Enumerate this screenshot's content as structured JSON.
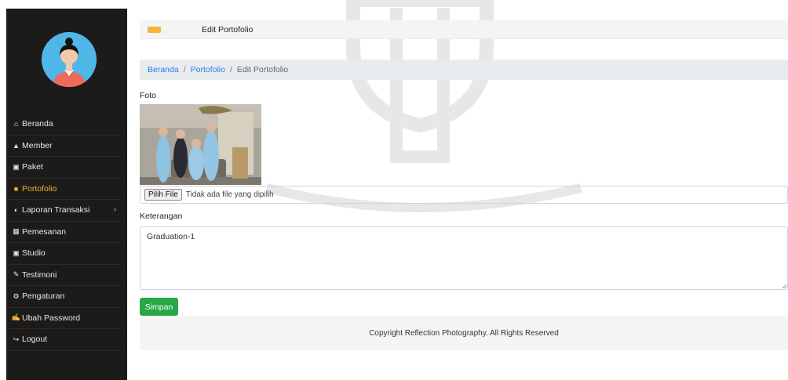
{
  "topbar": {
    "title": "Edit Portofolio"
  },
  "breadcrumb": {
    "home": "Beranda",
    "section": "Portofolio",
    "current": "Edit Portofolio",
    "separator": "/"
  },
  "sidebar": {
    "items": [
      {
        "label": "Beranda",
        "icon": "home-icon",
        "glyph": "⌂"
      },
      {
        "label": "Member",
        "icon": "user-icon",
        "glyph": "▲"
      },
      {
        "label": "Paket",
        "icon": "image-icon",
        "glyph": "▣"
      },
      {
        "label": "Portofolio",
        "icon": "book-icon",
        "glyph": "■",
        "active": true
      },
      {
        "label": "Laporan Transaksi",
        "icon": "report-icon",
        "glyph": "◐",
        "chevron": "›"
      },
      {
        "label": "Pemesanan",
        "icon": "calendar-icon",
        "glyph": "▦"
      },
      {
        "label": "Studio",
        "icon": "studio-icon",
        "glyph": "▣"
      },
      {
        "label": "Testimoni",
        "icon": "pencil-icon",
        "glyph": "✎"
      },
      {
        "label": "Pengaturan",
        "icon": "gear-icon",
        "glyph": "⚙"
      },
      {
        "label": "Ubah Password",
        "icon": "edit-icon",
        "glyph": "✍"
      },
      {
        "label": "Logout",
        "icon": "logout-icon",
        "glyph": "↪"
      }
    ]
  },
  "form": {
    "photo_label": "Foto",
    "file_button": "Pilih File",
    "file_status": "Tidak ada file yang dipilih",
    "description_label": "Keterangan",
    "description_value": "Graduation-1",
    "save_label": "Simpan"
  },
  "footer": {
    "text": "Copyright Reflection Photography. All Rights Reserved"
  },
  "colors": {
    "sidebar_bg": "#1d1b1a",
    "active": "#f0b22f",
    "link": "#2c7ce8",
    "save": "#28a745",
    "toggle": "#f5b53a"
  }
}
